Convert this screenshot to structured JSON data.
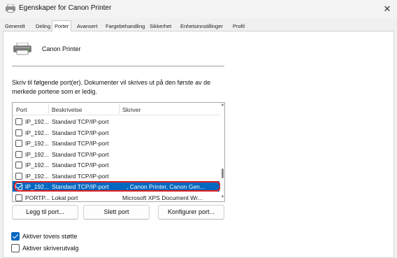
{
  "window": {
    "title": "Egenskaper for Canon Printer",
    "close_symbol": "✕"
  },
  "tabs": [
    {
      "label": "Generelt"
    },
    {
      "label": "Deling"
    },
    {
      "label": "Porter",
      "active": true
    },
    {
      "label": "Avansert"
    },
    {
      "label": "Fargebehandling"
    },
    {
      "label": "Sikkerhet"
    },
    {
      "label": "Enhetsinnstillinger"
    },
    {
      "label": "Profil"
    }
  ],
  "printer": {
    "name": "Canon Printer",
    "icon": "printer-icon"
  },
  "description": "Skriv til følgende port(er). Dokumenter vil skrives ut på den første av de merkede portene som er ledig.",
  "port_list": {
    "columns": [
      "Port",
      "Beskrivelse",
      "Skriver"
    ],
    "rows": [
      {
        "port": "IP_192...",
        "description": "Standard TCP/IP-port",
        "printer": "",
        "checked": false,
        "selected": false
      },
      {
        "port": "IP_192...",
        "description": "Standard TCP/IP-port",
        "printer": "",
        "checked": false,
        "selected": false
      },
      {
        "port": "IP_192...",
        "description": "Standard TCP/IP-port",
        "printer": "",
        "checked": false,
        "selected": false
      },
      {
        "port": "IP_192...",
        "description": "Standard TCP/IP-port",
        "printer": "",
        "checked": false,
        "selected": false
      },
      {
        "port": "IP_192...",
        "description": "Standard TCP/IP-port",
        "printer": "",
        "checked": false,
        "selected": false
      },
      {
        "port": "IP_192...",
        "description": "Standard TCP/IP-port",
        "printer": "",
        "checked": false,
        "selected": false
      },
      {
        "port": "IP_192...",
        "description": "Standard TCP/IP-port",
        "printer": ", Canon Printer, Canon Gen...",
        "checked": true,
        "selected": true
      },
      {
        "port": "PORTP...",
        "description": "Lokal port",
        "printer": "Microsoft XPS Document Wr...",
        "checked": false,
        "selected": false
      }
    ]
  },
  "buttons": {
    "add_port": "Legg til port...",
    "delete_port": "Slett port",
    "configure_port": "Konfigurer port..."
  },
  "options": {
    "bidirectional": {
      "label": "Aktiver toveis støtte",
      "checked": true
    },
    "pooling": {
      "label": "Aktiver skriverutvalg",
      "checked": false
    }
  },
  "colors": {
    "accent": "#0067c0",
    "highlight_ring": "#e02020"
  }
}
